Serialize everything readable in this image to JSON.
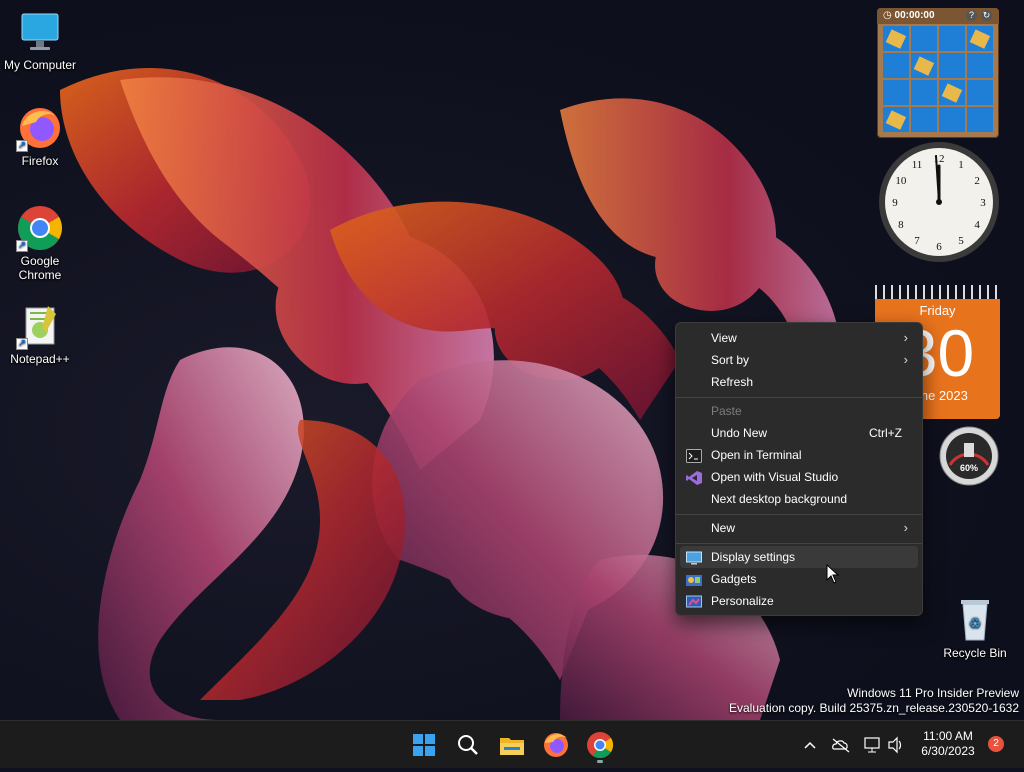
{
  "desktop": {
    "icons": [
      {
        "label": "My Computer"
      },
      {
        "label": "Firefox"
      },
      {
        "label": "Google Chrome"
      },
      {
        "label": "Notepad++"
      },
      {
        "label": "Recycle Bin"
      }
    ],
    "watermark": {
      "line1": "Windows 11 Pro Insider Preview",
      "line2": "Evaluation copy. Build 25375.zn_release.230520-1632"
    }
  },
  "gadgets": {
    "puzzle": {
      "timer": "00:00:00"
    },
    "clock": {
      "hour_marks": [
        "12",
        "1",
        "2",
        "3",
        "4",
        "5",
        "6",
        "7",
        "8",
        "9",
        "10",
        "11"
      ]
    },
    "calendar": {
      "weekday": "Friday",
      "day": "30",
      "month_year": "June 2023"
    },
    "meter": {
      "percent": "60%"
    }
  },
  "context_menu": {
    "items": [
      {
        "label": "View",
        "submenu": true
      },
      {
        "label": "Sort by",
        "submenu": true
      },
      {
        "label": "Refresh"
      },
      {
        "label": "Paste",
        "disabled": true
      },
      {
        "label": "Undo New",
        "shortcut": "Ctrl+Z"
      },
      {
        "label": "Open in Terminal",
        "icon": "terminal-icon"
      },
      {
        "label": "Open with Visual Studio",
        "icon": "visual-studio-icon"
      },
      {
        "label": "Next desktop background"
      },
      {
        "label": "New",
        "submenu": true
      },
      {
        "label": "Display settings",
        "icon": "display-icon",
        "hovered": true
      },
      {
        "label": "Gadgets",
        "icon": "gadgets-icon"
      },
      {
        "label": "Personalize",
        "icon": "personalize-icon"
      }
    ]
  },
  "taskbar": {
    "apps": [
      "start-icon",
      "search-icon",
      "file-explorer-icon",
      "firefox-icon",
      "chrome-icon"
    ],
    "clock": {
      "time": "11:00 AM",
      "date": "6/30/2023"
    },
    "notification_count": "2"
  },
  "colors": {
    "menu_bg": "#2b2b2b",
    "taskbar_bg": "#1c1c1c",
    "calendar_orange": "#e8731d",
    "notification_badge": "#e8533d"
  }
}
